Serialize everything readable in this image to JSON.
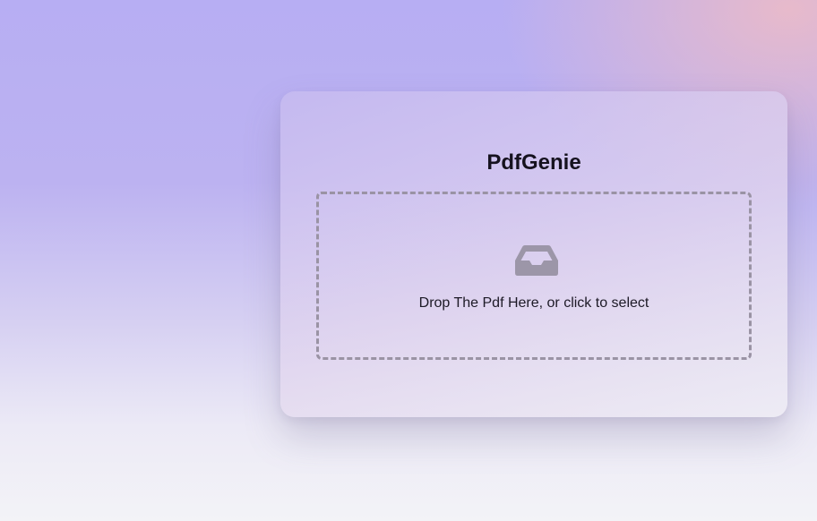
{
  "app": {
    "title": "PdfGenie"
  },
  "dropzone": {
    "icon": "inbox-icon",
    "text": "Drop The Pdf Here, or click to select",
    "border_color": "#9a93a4"
  },
  "colors": {
    "background_top": "#b7aef3",
    "background_bottom": "#f3f3f7",
    "accent_pink": "#f0bcc4",
    "title_color": "#16121f",
    "icon_color": "#9c96a8"
  }
}
